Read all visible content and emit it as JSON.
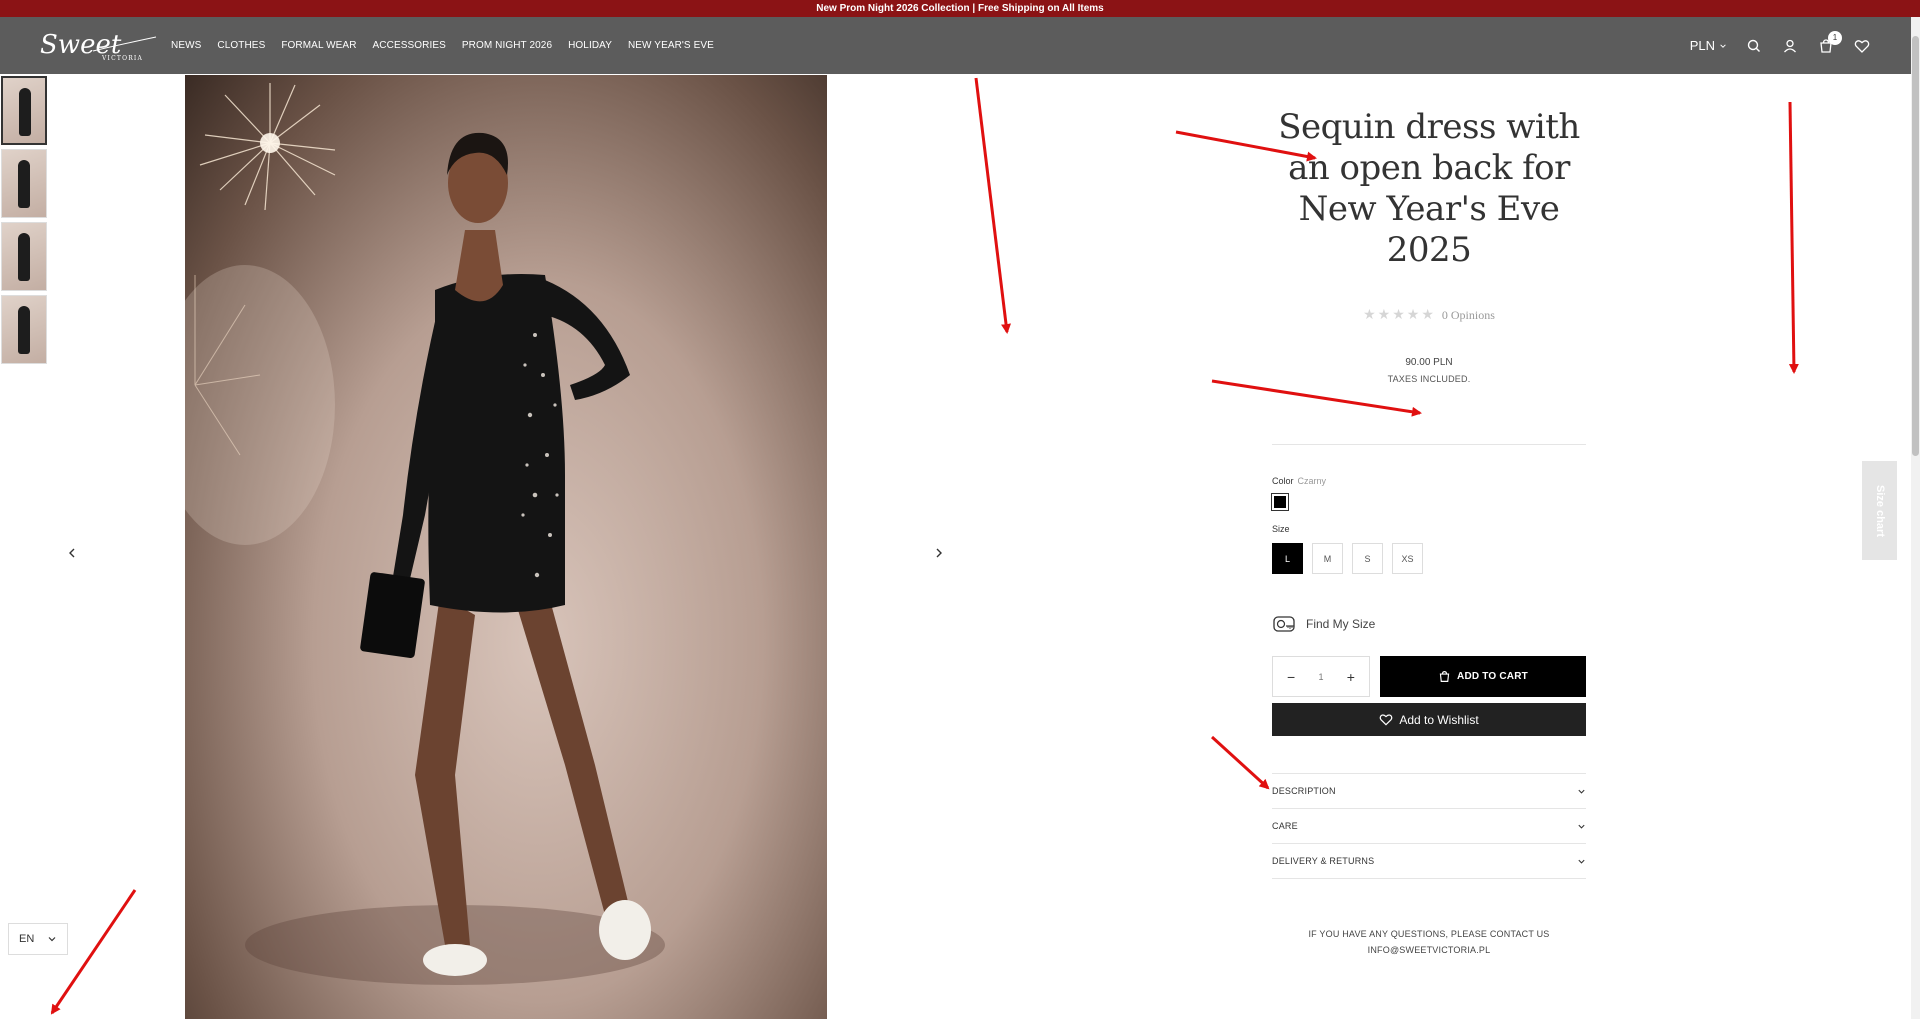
{
  "announcement": "New Prom Night 2026 Collection | Free Shipping on All Items",
  "logo": {
    "script": "Sweet",
    "sub": "VICTORIA"
  },
  "nav": [
    "NEWS",
    "CLOTHES",
    "FORMAL WEAR",
    "ACCESSORIES",
    "PROM NIGHT 2026",
    "HOLIDAY",
    "NEW YEAR'S EVE"
  ],
  "header": {
    "currency": "PLN",
    "cart_count": "1"
  },
  "product": {
    "title": "Sequin dress with an open back for New Year's Eve 2025",
    "rating_text": "0 Opinions",
    "price": "90.00 PLN",
    "tax_note": "TAXES INCLUDED.",
    "color_label": "Color",
    "color_value": "Czarny",
    "size_label": "Size",
    "sizes": [
      "L",
      "M",
      "S",
      "XS"
    ],
    "find_size": "Find My Size",
    "quantity": "1",
    "add_to_cart": "ADD TO CART",
    "add_to_wishlist": "Add to Wishlist",
    "accordions": [
      "DESCRIPTION",
      "CARE",
      "DELIVERY & RETURNS"
    ],
    "contact_line1": "IF YOU HAVE ANY QUESTIONS, PLEASE CONTACT US",
    "contact_line2": "INFO@SWEETVICTORIA.PL"
  },
  "size_chart": "Size chart",
  "language": "EN",
  "colors": {
    "announce_bg": "#8b1315",
    "header_bg": "#5c5c5c",
    "annotation": "#e01010"
  }
}
